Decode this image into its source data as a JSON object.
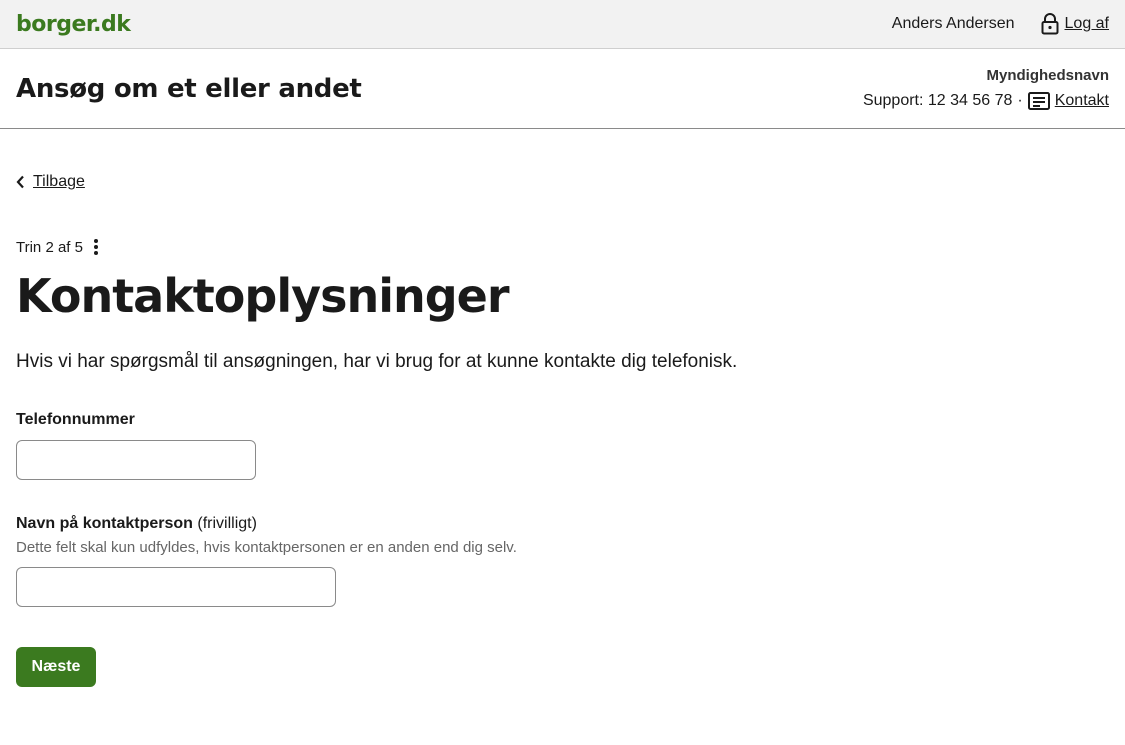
{
  "topbar": {
    "logo": "borger.dk",
    "user_name": "Anders Andersen",
    "logout_label": "Log af",
    "logout_icon": "lock-icon"
  },
  "appbar": {
    "title": "Ansøg om et eller andet",
    "authority_name": "Myndighedsnavn",
    "support_text": "Support: 12 34 56 78",
    "separator": "·",
    "contact_label": "Kontakt",
    "contact_icon": "message-icon"
  },
  "nav": {
    "back_label": "Tilbage",
    "back_icon": "chevron-left-icon"
  },
  "step": {
    "text": "Trin 2 af 5",
    "menu_icon": "more-vertical-icon"
  },
  "page": {
    "heading": "Kontaktoplysninger",
    "intro": "Hvis vi har spørgsmål til ansøgningen, har vi brug for at kunne kontakte dig telefonisk."
  },
  "form": {
    "phone": {
      "label": "Telefonnummer",
      "value": ""
    },
    "contact_person": {
      "label": "Navn på kontaktperson",
      "optional": "(frivilligt)",
      "hint": "Dette felt skal kun udfyldes, hvis kontaktpersonen er en anden end dig selv.",
      "value": ""
    },
    "next_label": "Næste"
  },
  "colors": {
    "brand_green": "#3b7a1f",
    "topbar_bg": "#f2f2f2"
  }
}
